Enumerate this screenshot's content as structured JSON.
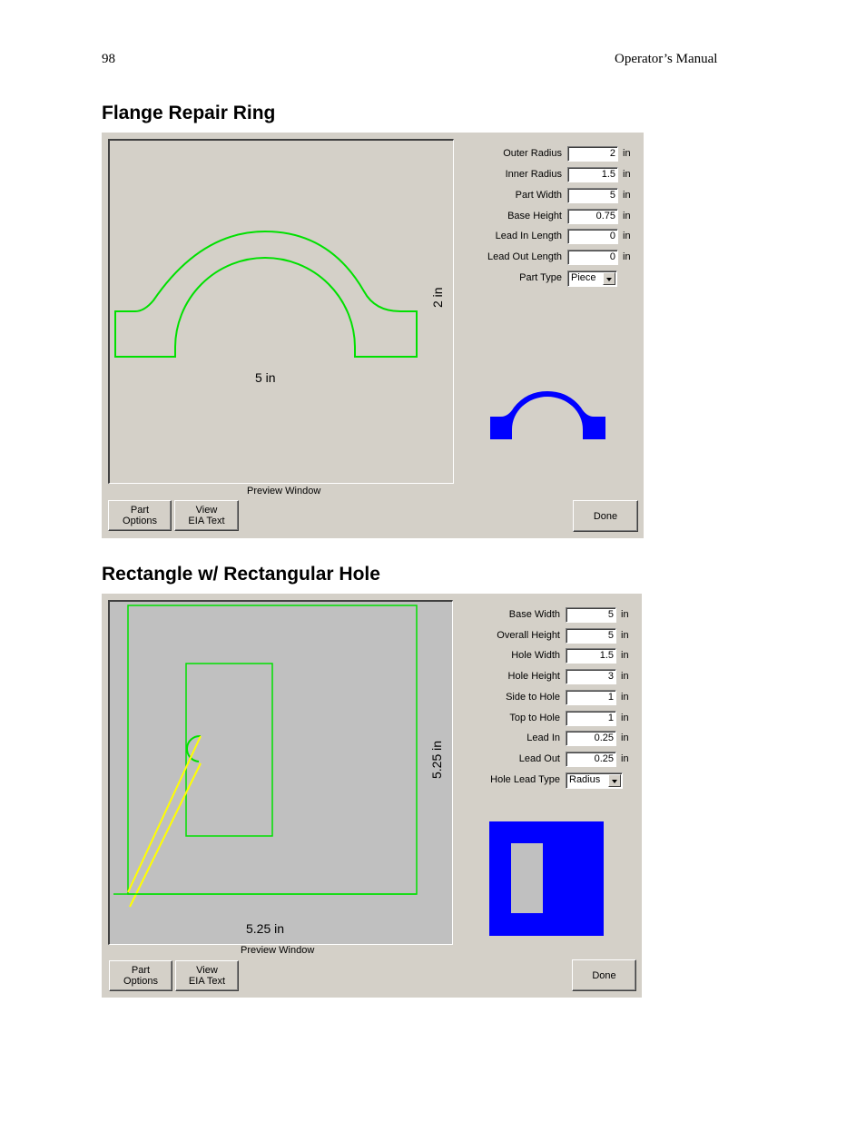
{
  "header": {
    "page_number": "98",
    "manual_title": "Operator’s Manual"
  },
  "sections": [
    {
      "title": "Flange Repair Ring",
      "fields": [
        {
          "label": "Outer Radius",
          "value": "2",
          "unit": "in"
        },
        {
          "label": "Inner Radius",
          "value": "1.5",
          "unit": "in"
        },
        {
          "label": "Part Width",
          "value": "5",
          "unit": "in"
        },
        {
          "label": "Base Height",
          "value": "0.75",
          "unit": "in"
        },
        {
          "label": "Lead In Length",
          "value": "0",
          "unit": "in"
        },
        {
          "label": "Lead Out Length",
          "value": "0",
          "unit": "in"
        }
      ],
      "select": {
        "label": "Part Type",
        "value": "Piece"
      },
      "preview": {
        "caption": "Preview Window",
        "width_label": "5 in",
        "height_label": "2 in"
      },
      "buttons": {
        "part_options": "Part\nOptions",
        "view_eia": "View\nEIA Text",
        "done": "Done"
      },
      "colors": {
        "outline": "#00e000",
        "thumbnail": "#0000ff"
      }
    },
    {
      "title": "Rectangle w/ Rectangular Hole",
      "fields": [
        {
          "label": "Base Width",
          "value": "5",
          "unit": "in"
        },
        {
          "label": "Overall Height",
          "value": "5",
          "unit": "in"
        },
        {
          "label": "Hole Width",
          "value": "1.5",
          "unit": "in"
        },
        {
          "label": "Hole Height",
          "value": "3",
          "unit": "in"
        },
        {
          "label": "Side to Hole",
          "value": "1",
          "unit": "in"
        },
        {
          "label": "Top to Hole",
          "value": "1",
          "unit": "in"
        },
        {
          "label": "Lead In",
          "value": "0.25",
          "unit": "in"
        },
        {
          "label": "Lead Out",
          "value": "0.25",
          "unit": "in"
        }
      ],
      "select": {
        "label": "Hole Lead Type",
        "value": "Radius"
      },
      "preview": {
        "caption": "Preview Window",
        "width_label": "5.25 in",
        "height_label": "5.25 in"
      },
      "buttons": {
        "part_options": "Part\nOptions",
        "view_eia": "View\nEIA Text",
        "done": "Done"
      },
      "colors": {
        "outline": "#00e000",
        "lead_path": "#ffff00",
        "thumbnail": "#0000ff",
        "background": "#c0c0c0"
      }
    }
  ]
}
